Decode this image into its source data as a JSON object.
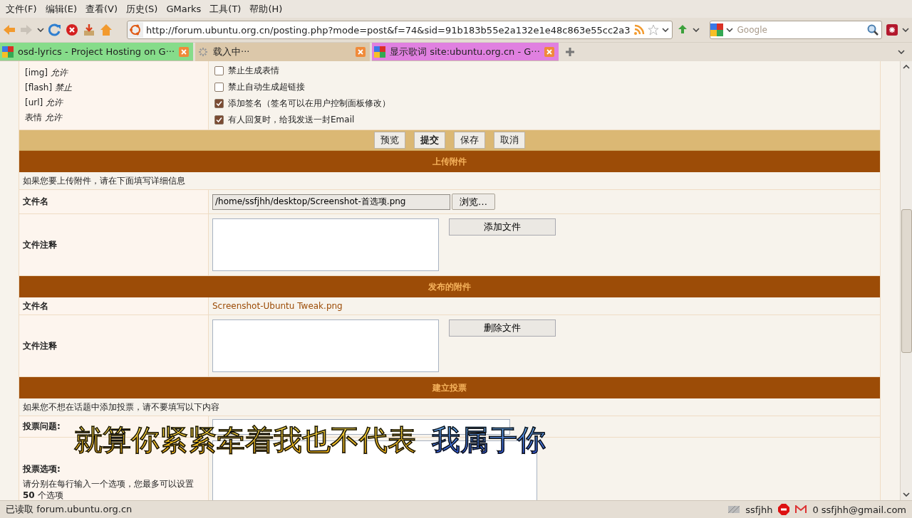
{
  "menu": [
    "文件(F)",
    "编辑(E)",
    "查看(V)",
    "历史(S)",
    "GMarks",
    "工具(T)",
    "帮助(H)"
  ],
  "address": {
    "value": "http://forum.ubuntu.org.cn/posting.php?mode=post&f=74&sid=91b183b55e2a132e1e48c863e55cc2a3"
  },
  "search": {
    "placeholder": "Google"
  },
  "tabs": [
    {
      "title": "osd-lyrics - Project Hosting on G···",
      "selected": false,
      "loading": false,
      "color": "#86dc8a"
    },
    {
      "title": "载入中···",
      "selected": true,
      "loading": true,
      "color": "#dcc8aa"
    },
    {
      "title": "显示歌词 site:ubuntu.org.cn - G···",
      "selected": false,
      "loading": false,
      "color": "#e080e0"
    }
  ],
  "options": {
    "rules": [
      {
        "tag": "[img]",
        "value": "允许"
      },
      {
        "tag": "[flash]",
        "value": "禁止"
      },
      {
        "tag": "[url]",
        "value": "允许"
      },
      {
        "tag": "表情",
        "value": "允许"
      }
    ],
    "checkboxes": [
      {
        "label": "禁止生成表情",
        "checked": false
      },
      {
        "label": "禁止自动生成超链接",
        "checked": false
      },
      {
        "label": "添加签名（签名可以在用户控制面板修改）",
        "checked": true
      },
      {
        "label": "有人回复时，给我发送一封Email",
        "checked": true
      }
    ]
  },
  "buttons": [
    {
      "label": "预览",
      "primary": false
    },
    {
      "label": "提交",
      "primary": true
    },
    {
      "label": "保存",
      "primary": false
    },
    {
      "label": "取消",
      "primary": false
    }
  ],
  "upload": {
    "title": "上传附件",
    "info": "如果您要上传附件，请在下面填写详细信息",
    "file_label": "文件名",
    "file_value": "/home/ssfjhh/desktop/Screenshot-首选项.png",
    "browse": "浏览…",
    "comment_label": "文件注释",
    "add": "添加文件"
  },
  "posted": {
    "title": "发布的附件",
    "file_label": "文件名",
    "file_link": "Screenshot-Ubuntu Tweak.png",
    "comment_label": "文件注释",
    "delete": "删除文件"
  },
  "poll": {
    "title": "建立投票",
    "info": "如果您不想在话题中添加投票，请不要填写以下内容",
    "question_label": "投票问题:",
    "options_label": "投票选项:",
    "options_hint": "请分别在每行输入一个选项，您最多可以设置 **50** 个选项"
  },
  "lyrics": [
    {
      "text": "就算你紧紧牵着我也不代表",
      "sung": true
    },
    {
      "text": "我属于你",
      "sung": false
    }
  ],
  "status": {
    "text": "已读取 forum.ubuntu.org.cn",
    "user": "ssfjhh",
    "mail": "0 ssfjhh@gmail.com"
  }
}
